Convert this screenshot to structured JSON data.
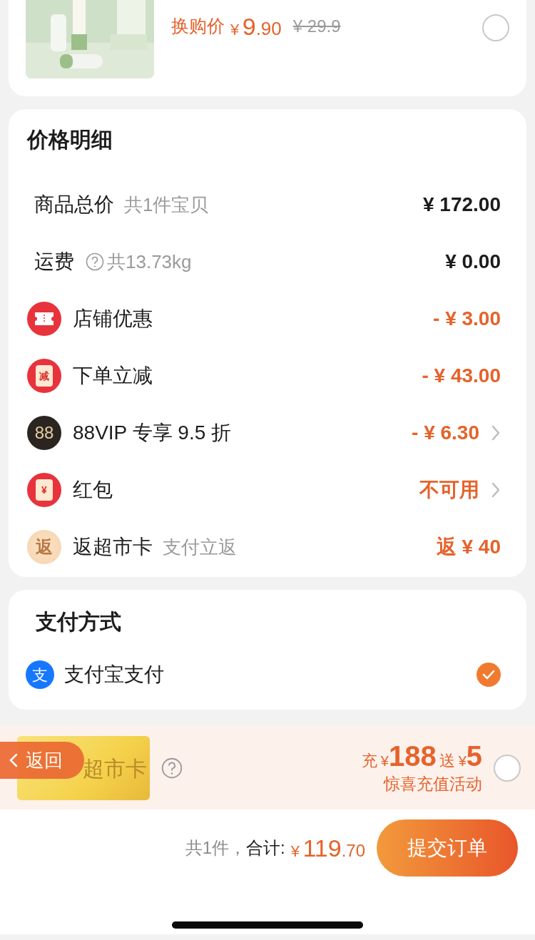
{
  "product": {
    "exchange_label": "换购价",
    "currency": "¥",
    "price_int": "9",
    "price_dec": ".90",
    "original_price": "¥ 29.9",
    "selected": false
  },
  "price_detail": {
    "title": "价格明细",
    "rows": [
      {
        "kind": "plain",
        "label": "商品总价",
        "note": "共1件宝贝",
        "value": "¥ 172.00",
        "highlight": false,
        "chevron": false
      },
      {
        "kind": "help",
        "label": "运费",
        "note": "共13.73kg",
        "value": "¥ 0.00",
        "highlight": false,
        "chevron": false
      },
      {
        "kind": "ticket",
        "label": "店铺优惠",
        "value": "- ¥ 3.00",
        "highlight": true,
        "chevron": false
      },
      {
        "kind": "packet",
        "icon_text": "减",
        "label": "下单立减",
        "value": "- ¥ 43.00",
        "highlight": true,
        "chevron": false
      },
      {
        "kind": "vip",
        "icon_text": "88",
        "label": "88VIP 专享 9.5 折",
        "value": "- ¥ 6.30",
        "highlight": true,
        "chevron": true
      },
      {
        "kind": "packet",
        "icon_text": "¥",
        "label": "红包",
        "value": "不可用",
        "highlight": true,
        "chevron": true
      },
      {
        "kind": "rebate",
        "icon_text": "返",
        "label": "返超市卡",
        "note": "支付立返",
        "value": "返 ¥ 40",
        "highlight": true,
        "chevron": false
      }
    ]
  },
  "payment": {
    "title": "支付方式",
    "methods": [
      {
        "icon_text": "支",
        "label": "支付宝支付",
        "selected": true
      }
    ]
  },
  "promo": {
    "card_label": "超市卡",
    "charge": "充",
    "currency_1": "¥",
    "amount": "188",
    "gift": "送",
    "currency_2": "¥",
    "gift_amount": "5",
    "subtitle": "惊喜充值活动",
    "selected": false
  },
  "back_button": {
    "label": "返回"
  },
  "footer": {
    "count": "共1件，",
    "total_label": "合计:",
    "currency": "¥",
    "total_int": "119",
    "total_dec": ".70",
    "submit": "提交订单"
  }
}
